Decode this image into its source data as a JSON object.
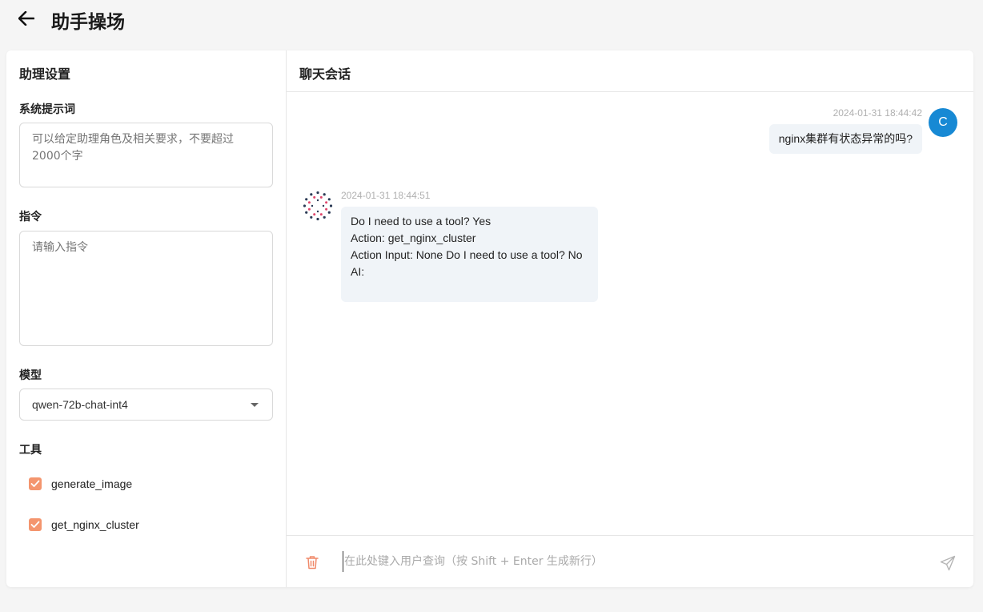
{
  "header": {
    "title": "助手操场"
  },
  "settings": {
    "title": "助理设置",
    "system_prompt": {
      "label": "系统提示词",
      "placeholder": "可以给定助理角色及相关要求，不要超过2000个字",
      "value": ""
    },
    "instruction": {
      "label": "指令",
      "placeholder": "请输入指令",
      "value": ""
    },
    "model": {
      "label": "模型",
      "selected": "qwen-72b-chat-int4"
    },
    "tools": {
      "label": "工具",
      "items": [
        {
          "name": "generate_image",
          "checked": true
        },
        {
          "name": "get_nginx_cluster",
          "checked": true
        }
      ]
    }
  },
  "chat": {
    "title": "聊天会话",
    "messages": [
      {
        "role": "user",
        "avatar": "C",
        "time": "2024-01-31 18:44:42",
        "lines": [
          "nginx集群有状态异常的吗?"
        ]
      },
      {
        "role": "assistant",
        "time": "2024-01-31 18:44:51",
        "lines": [
          "Do I need to use a tool? Yes",
          "Action: get_nginx_cluster",
          "Action Input: None Do I need to use a tool? No",
          "AI:"
        ]
      }
    ],
    "input": {
      "placeholder": "在此处键入用户查询（按 Shift + Enter 生成新行）",
      "value": ""
    }
  },
  "colors": {
    "checkbox": "#f4956e",
    "user_avatar": "#1789d4",
    "bubble": "#f0f4f8",
    "trash": "#f08a6a"
  },
  "icons": {
    "back": "arrow-left-icon",
    "trash": "trash-icon",
    "send": "send-icon",
    "assistant": "assistant-avatar-icon",
    "check": "check-icon",
    "dropdown": "caret-down-icon"
  }
}
